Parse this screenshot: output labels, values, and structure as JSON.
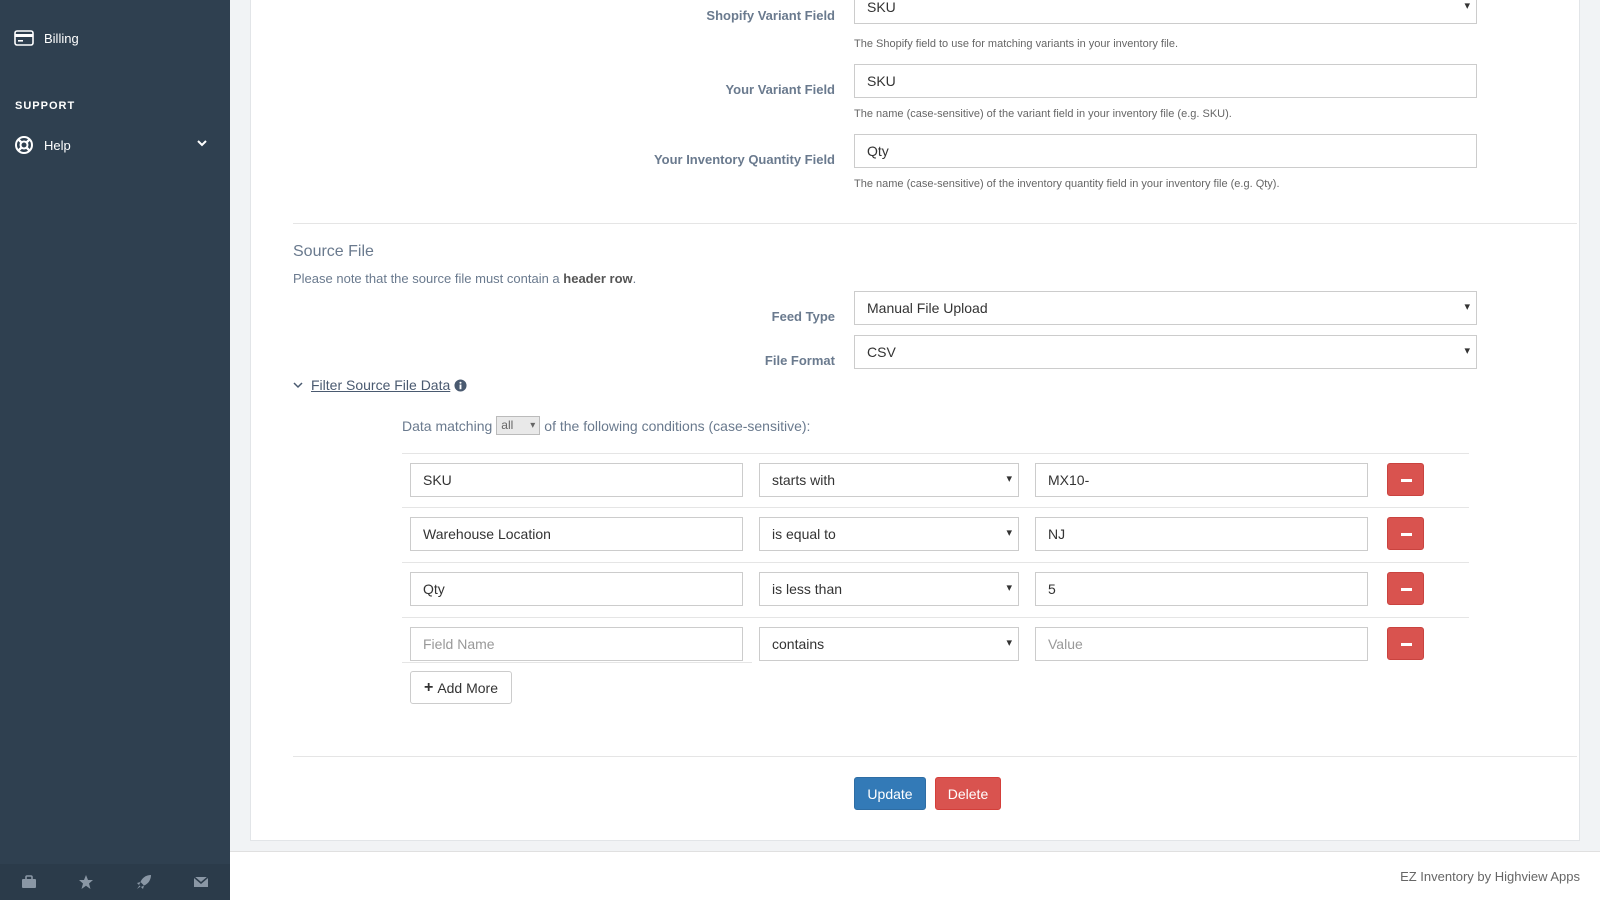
{
  "sidebar": {
    "billing_label": "Billing",
    "support_heading": "SUPPORT",
    "help_label": "Help",
    "bottom_icons": [
      "briefcase-icon",
      "star-icon",
      "rocket-icon",
      "envelope-icon"
    ]
  },
  "form": {
    "shopify_variant": {
      "label": "Shopify Variant Field",
      "value": "SKU",
      "help": "The Shopify field to use for matching variants in your inventory file."
    },
    "your_variant": {
      "label": "Your Variant Field",
      "value": "SKU",
      "help": "The name (case-sensitive) of the variant field in your inventory file (e.g. SKU)."
    },
    "quantity_field": {
      "label": "Your Inventory Quantity Field",
      "value": "Qty",
      "help": "The name (case-sensitive) of the inventory quantity field in your inventory file (e.g. Qty)."
    }
  },
  "source": {
    "title": "Source File",
    "note_prefix": "Please note that the source file must contain a ",
    "note_bold": "header row",
    "note_suffix": ".",
    "feed_type": {
      "label": "Feed Type",
      "value": "Manual File Upload"
    },
    "file_format": {
      "label": "File Format",
      "value": "CSV"
    }
  },
  "filter": {
    "toggle_label": "Filter Source File Data",
    "match_prefix": "Data matching",
    "match_value": "all",
    "match_suffix": "of the following conditions (case-sensitive):",
    "conditions": [
      {
        "field": "SKU",
        "operator": "starts with",
        "value": "MX10-"
      },
      {
        "field": "Warehouse Location",
        "operator": "is equal to",
        "value": "NJ"
      },
      {
        "field": "Qty",
        "operator": "is less than",
        "value": "5"
      },
      {
        "field": "",
        "field_placeholder": "Field Name",
        "operator": "contains",
        "value": "",
        "value_placeholder": "Value"
      }
    ],
    "add_more_label": "Add More"
  },
  "actions": {
    "update_label": "Update",
    "delete_label": "Delete"
  },
  "footer": {
    "text": "EZ Inventory by Highview Apps"
  },
  "colors": {
    "sidebar_bg": "#2f4050",
    "primary": "#337ab7",
    "danger": "#d9534f"
  }
}
